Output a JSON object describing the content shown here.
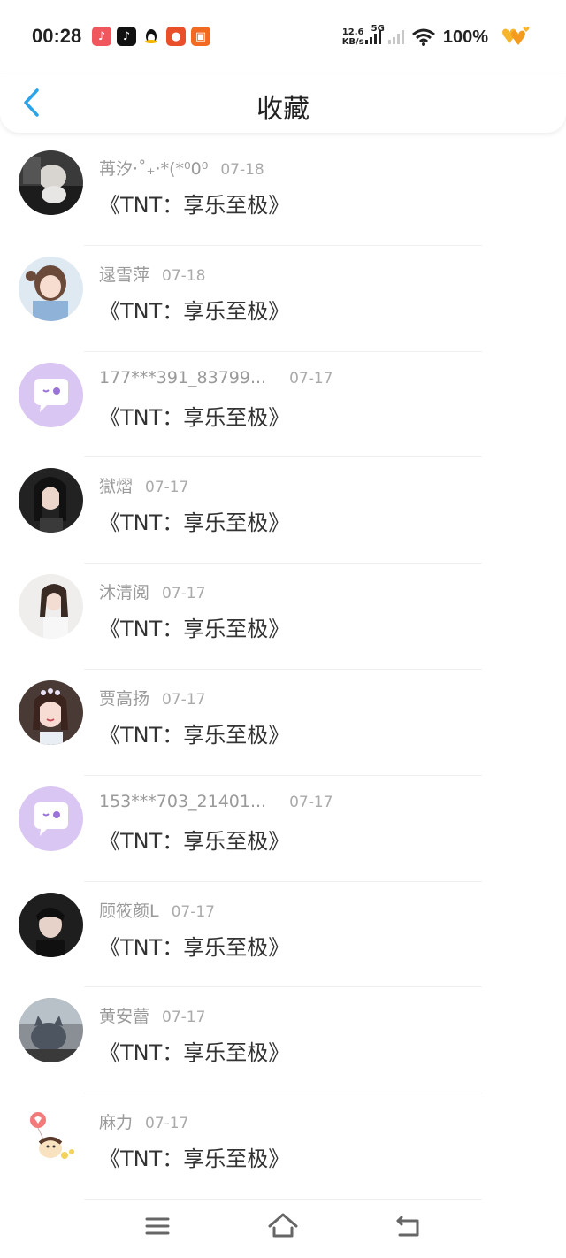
{
  "status_bar": {
    "time": "00:28",
    "speed_value": "12.6",
    "speed_unit": "KB/s",
    "network": "5G",
    "battery": "100%"
  },
  "header": {
    "title": "收藏",
    "accent_color": "#2aa3e8"
  },
  "favorites": [
    {
      "user": "苒汐·˚₊‧*(*⁰0⁰",
      "date": "07-18",
      "content": "《TNT：享乐至极》",
      "avatar": "photo-dark"
    },
    {
      "user": "逯雪萍",
      "date": "07-18",
      "content": "《TNT：享乐至极》",
      "avatar": "anime-girl"
    },
    {
      "user": "177***391_83799...",
      "date": "07-17",
      "content": "《TNT：享乐至极》",
      "avatar": "default-chat"
    },
    {
      "user": "獄熠",
      "date": "07-17",
      "content": "《TNT：享乐至极》",
      "avatar": "photo-woman-dark"
    },
    {
      "user": "沐清阅",
      "date": "07-17",
      "content": "《TNT：享乐至极》",
      "avatar": "photo-woman-light"
    },
    {
      "user": "贾高扬",
      "date": "07-17",
      "content": "《TNT：享乐至极》",
      "avatar": "photo-woman-crown"
    },
    {
      "user": "153***703_21401...",
      "date": "07-17",
      "content": "《TNT：享乐至极》",
      "avatar": "default-chat"
    },
    {
      "user": "顾筱颜L",
      "date": "07-17",
      "content": "《TNT：享乐至极》",
      "avatar": "photo-man"
    },
    {
      "user": "黄安蕾",
      "date": "07-17",
      "content": "《TNT：享乐至极》",
      "avatar": "photo-cat"
    },
    {
      "user": "麻力",
      "date": "07-17",
      "content": "《TNT：享乐至极》",
      "avatar": "cartoon-balloon"
    }
  ],
  "nav": {
    "menu_icon": "menu-icon",
    "home_icon": "home-icon",
    "back_icon": "return-icon"
  }
}
